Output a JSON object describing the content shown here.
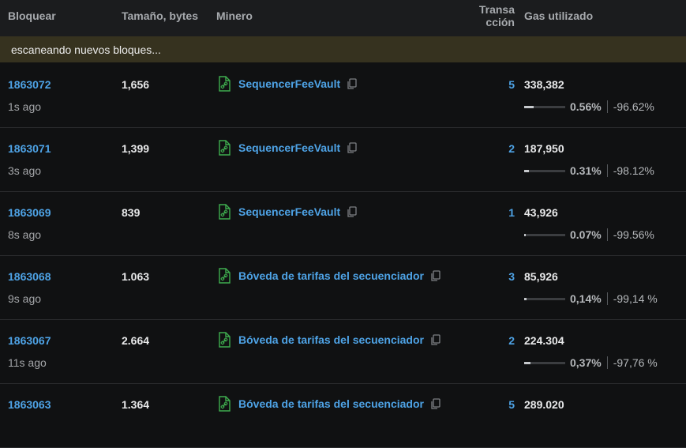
{
  "header": {
    "block": "Bloquear",
    "size": "Tamaño, bytes",
    "miner": "Minero",
    "tx_line1": "Transa",
    "tx_line2": "cción",
    "gas": "Gas utilizado"
  },
  "scan_text": "escaneando nuevos bloques...",
  "colors": {
    "link": "#4ea3e6",
    "scan_bg": "#36321f",
    "file_icon": "#3fae4f"
  },
  "rows": [
    {
      "block": "1863072",
      "age": "1s ago",
      "size": "1,656",
      "miner": "SequencerFeeVault",
      "tx": "5",
      "gas": "338,382",
      "gas_pct": "0.56%",
      "gas_fraction": 0.0056,
      "delta": "-96.62%"
    },
    {
      "block": "1863071",
      "age": "3s ago",
      "size": "1,399",
      "miner": "SequencerFeeVault",
      "tx": "2",
      "gas": "187,950",
      "gas_pct": "0.31%",
      "gas_fraction": 0.0031,
      "delta": "-98.12%"
    },
    {
      "block": "1863069",
      "age": "8s ago",
      "size": "839",
      "miner": "SequencerFeeVault",
      "tx": "1",
      "gas": "43,926",
      "gas_pct": "0.07%",
      "gas_fraction": 0.0007,
      "delta": "-99.56%"
    },
    {
      "block": "1863068",
      "age": "9s ago",
      "size": "1.063",
      "miner": "Bóveda de tarifas del secuenciador",
      "tx": "3",
      "gas": "85,926",
      "gas_pct": "0,14%",
      "gas_fraction": 0.0014,
      "delta": "-99,14 %"
    },
    {
      "block": "1863067",
      "age": "11s ago",
      "size": "2.664",
      "miner": "Bóveda de tarifas del secuenciador",
      "tx": "2",
      "gas": "224.304",
      "gas_pct": "0,37%",
      "gas_fraction": 0.0037,
      "delta": "-97,76 %"
    },
    {
      "block": "1863063",
      "age": "",
      "size": "1.364",
      "miner": "Bóveda de tarifas del secuenciador",
      "tx": "5",
      "gas": "289.020",
      "gas_pct": "",
      "gas_fraction": 0,
      "delta": ""
    }
  ]
}
